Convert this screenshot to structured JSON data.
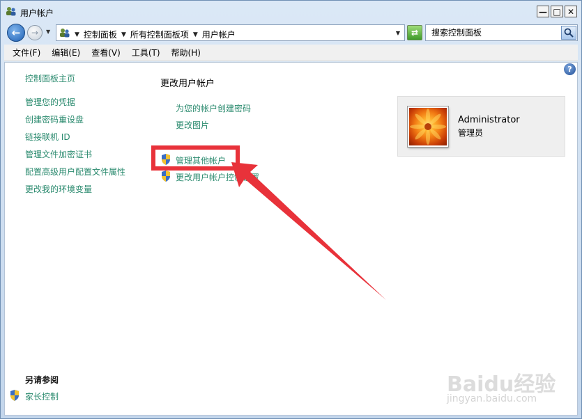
{
  "window": {
    "title": "用户帐户",
    "buttons": {
      "minimize": "—",
      "maximize": "□",
      "close": "✕"
    }
  },
  "navbar": {
    "breadcrumbs": [
      "控制面板",
      "所有控制面板项",
      "用户帐户"
    ],
    "search_placeholder": "搜索控制面板"
  },
  "menubar": {
    "items": [
      "文件(F)",
      "编辑(E)",
      "查看(V)",
      "工具(T)",
      "帮助(H)"
    ]
  },
  "sidebar": {
    "home": "控制面板主页",
    "links": [
      "管理您的凭据",
      "创建密码重设盘",
      "链接联机 ID",
      "管理文件加密证书",
      "配置高级用户配置文件属性",
      "更改我的环境变量"
    ],
    "see_also_heading": "另请参阅",
    "see_also_links": [
      "家长控制"
    ]
  },
  "main": {
    "title": "更改用户帐户",
    "links": [
      "为您的帐户创建密码",
      "更改图片"
    ],
    "shield_links": [
      "管理其他帐户",
      "更改用户帐户控制设置"
    ]
  },
  "user": {
    "name": "Administrator",
    "role": "管理员"
  },
  "watermark": {
    "brand": "Baidu经验",
    "url": "jingyan.baidu.com"
  },
  "colors": {
    "link": "#2a8a6e",
    "annotation": "#e8323a"
  }
}
